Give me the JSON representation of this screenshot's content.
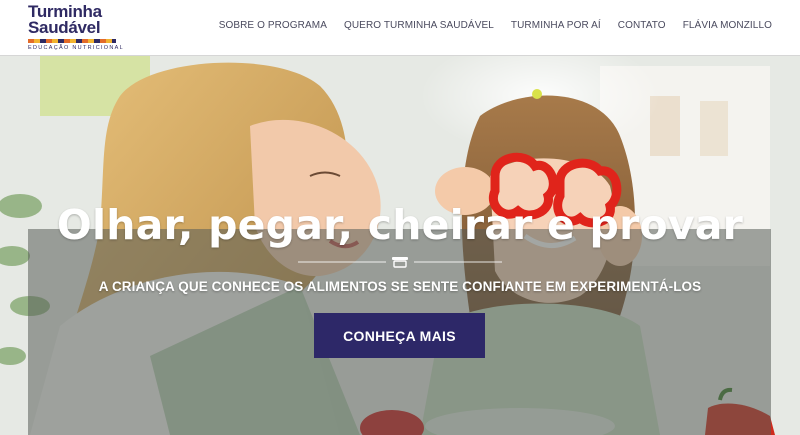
{
  "logo": {
    "line1": "Turminha",
    "line2": "Saudável",
    "tagline": "EDUCAÇÃO NUTRICIONAL"
  },
  "nav": {
    "items": [
      {
        "label": "SOBRE O PROGRAMA"
      },
      {
        "label": "QUERO TURMINHA SAUDÁVEL"
      },
      {
        "label": "TURMINHA POR AÍ"
      },
      {
        "label": "CONTATO"
      },
      {
        "label": "FLÁVIA MONZILLO"
      }
    ]
  },
  "hero": {
    "headline": "Olhar, pegar, cheirar e provar",
    "subline": "A CRIANÇA QUE CONHECE OS ALIMENTOS SE SENTE CONFIANTE EM EXPERIMENTÁ-LOS",
    "cta_label": "CONHEÇA MAIS"
  },
  "colors": {
    "brand": "#2f2a63",
    "cta": "#2d2868",
    "accent_orange": "#e36b2a",
    "accent_yellow": "#f2b431"
  }
}
